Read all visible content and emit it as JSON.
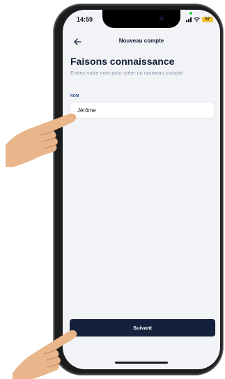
{
  "status_bar": {
    "time": "14:59",
    "battery": "57",
    "battery_color": "#f4c430"
  },
  "header": {
    "title": "Nouveau compte",
    "back_icon": "arrow-left-icon"
  },
  "page": {
    "title": "Faisons connaissance",
    "subtitle": "Entrez votre nom pour créer un nouveau compte"
  },
  "form": {
    "name_label": "NOM",
    "name_value": "Jérôme"
  },
  "actions": {
    "next_label": "Suivant",
    "next_color": "#14213d"
  },
  "overlays": {
    "hand_icon": "pointing-hand-icon"
  }
}
